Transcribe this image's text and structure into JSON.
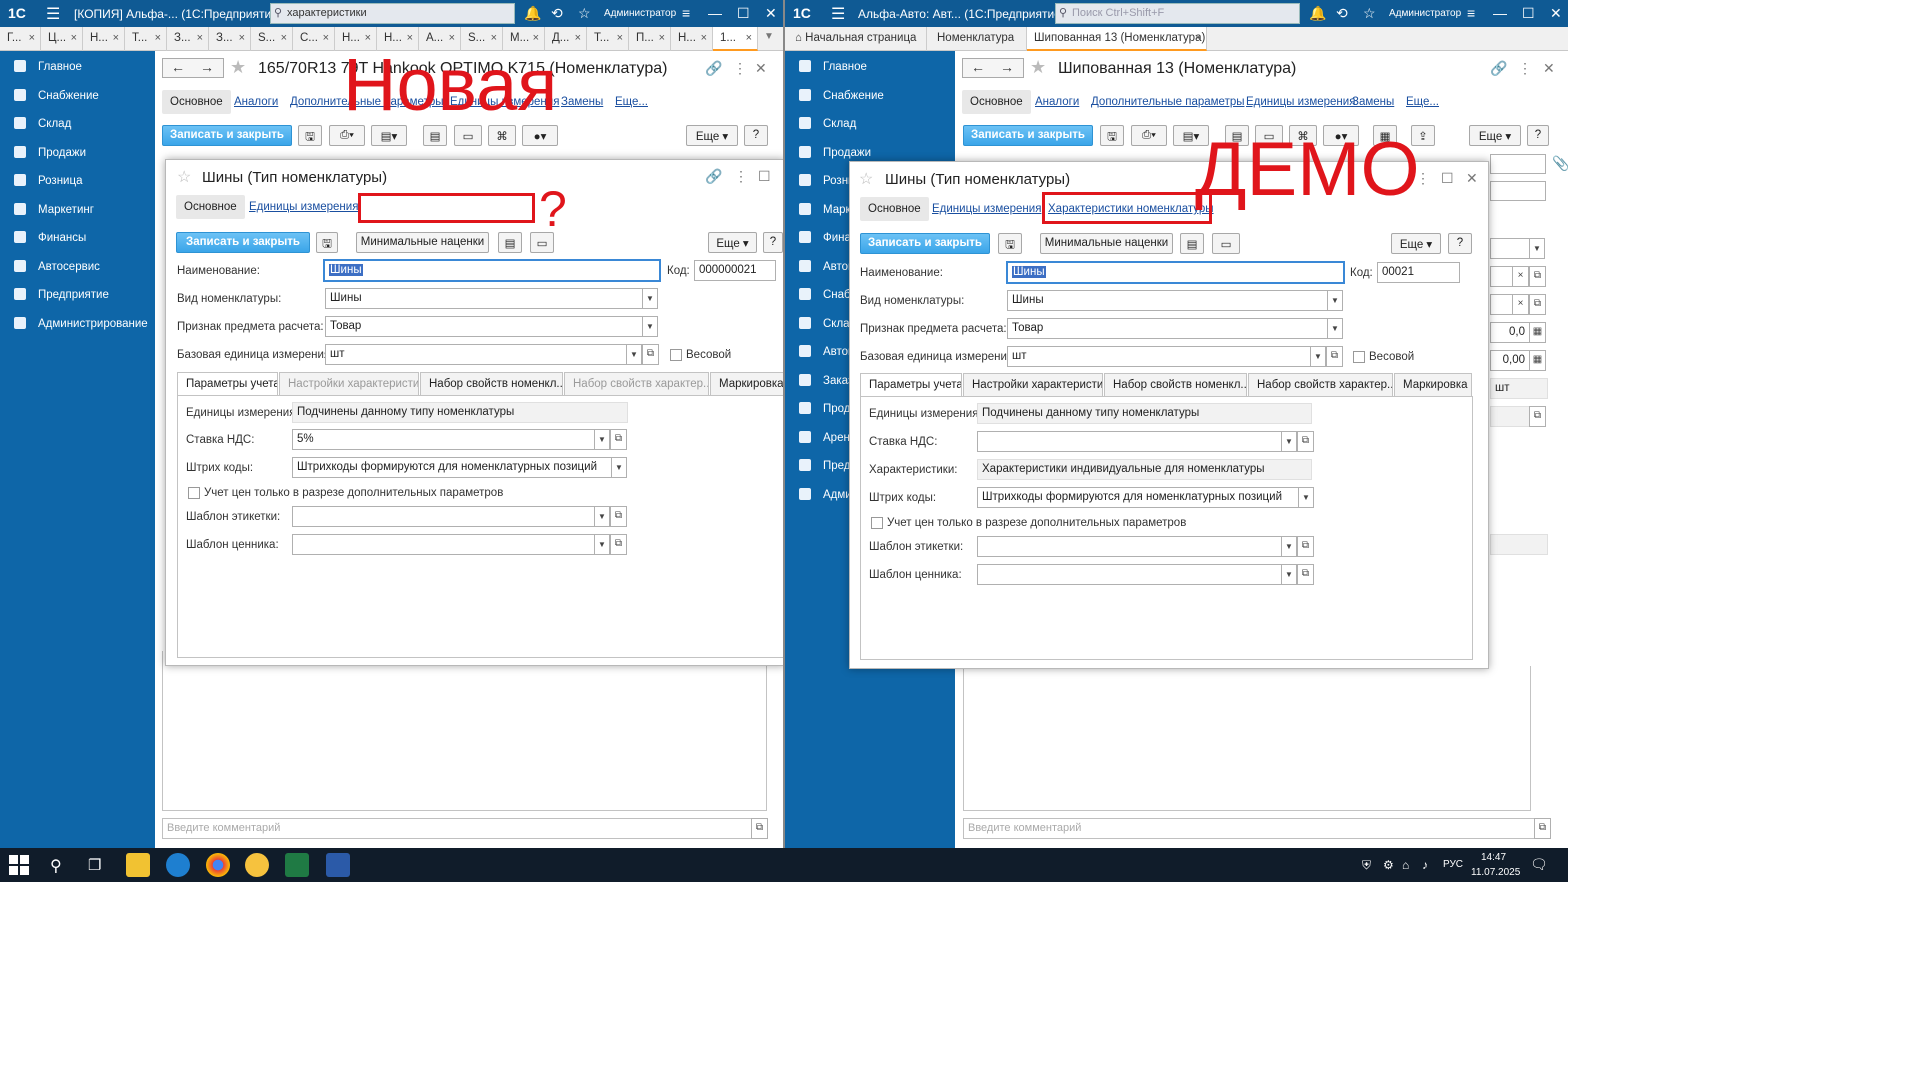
{
  "left": {
    "title": "[КОПИЯ] Альфа-... (1С:Предприятие)",
    "search_value": "характеристики",
    "user": "Администратор",
    "tabs": [
      "Г...",
      "Ц...",
      "Н...",
      "Т...",
      "З...",
      "З...",
      "S...",
      "С...",
      "Н...",
      "Н...",
      "А...",
      "S...",
      "М...",
      "Д...",
      "Т...",
      "П...",
      "Н...",
      "1..."
    ],
    "form_title": "165/70R13 79T Hankook OPTIMO K715 (Номенклатура)",
    "nav": [
      "Основное",
      "Аналоги",
      "Дополнительные параметры",
      "Единицы измерения",
      "Замены",
      "Еще..."
    ],
    "save_close": "Записать и закрыть",
    "more": "Еще",
    "help": "?",
    "comment_placeholder": "Введите комментарий",
    "annotation": "Новая",
    "annotation_q": "?",
    "dialog": {
      "title": "Шины (Тип номенклатуры)",
      "nav_main": "Основное",
      "nav_units": "Единицы измерения",
      "save_close": "Записать и закрыть",
      "min_markup": "Минимальные наценки",
      "more": "Еще",
      "help": "?",
      "name_label": "Наименование:",
      "name_value": "Шины",
      "code_label": "Код:",
      "code_value": "000000021",
      "kind_label": "Вид номенклатуры:",
      "kind_value": "Шины",
      "attr_label": "Признак предмета расчета:",
      "attr_value": "Товар",
      "unit_label": "Базовая единица измерения:",
      "unit_value": "шт",
      "weight_label": "Весовой",
      "tabs": [
        "Параметры учета",
        "Настройки характеристик",
        "Набор свойств номенкл...",
        "Набор свойств характер...",
        "Маркировка"
      ],
      "units_label": "Единицы измерения:",
      "units_value": "Подчинены данному типу номенклатуры",
      "vat_label": "Ставка НДС:",
      "vat_value": "5%",
      "barcode_label": "Штрих коды:",
      "barcode_value": "Штрихкоды формируются для номенклатурных позиций",
      "price_check": "Учет цен только в разрезе дополнительных параметров",
      "label_tpl": "Шаблон этикетки:",
      "price_tpl": "Шаблон ценника:"
    }
  },
  "right": {
    "title": "Альфа-Авто: Авт... (1С:Предприятие)",
    "search_placeholder": "Поиск Ctrl+Shift+F",
    "user": "Администратор",
    "tabs": [
      "Начальная страница",
      "Номенклатура",
      "Шипованная 13 (Номенклатура)"
    ],
    "form_title": "Шипованная 13 (Номенклатура)",
    "nav": [
      "Основное",
      "Аналоги",
      "Дополнительные параметры",
      "Единицы измерения",
      "Замены",
      "Еще..."
    ],
    "save_close": "Записать и закрыть",
    "more": "Еще",
    "help": "?",
    "comment_placeholder": "Введите комментарий",
    "annotation": "ДЕМО",
    "side_values": [
      "0,0",
      "0,00",
      "шт"
    ],
    "dialog": {
      "title": "Шины (Тип номенклатуры)",
      "nav_main": "Основное",
      "nav_units": "Единицы измерения",
      "nav_chars": "Характеристики номенклатуры",
      "save_close": "Записать и закрыть",
      "min_markup": "Минимальные наценки",
      "more": "Еще",
      "help": "?",
      "name_label": "Наименование:",
      "name_value": "Шины",
      "code_label": "Код:",
      "code_value": "00021",
      "kind_label": "Вид номенклатуры:",
      "kind_value": "Шины",
      "attr_label": "Признак предмета расчета:",
      "attr_value": "Товар",
      "unit_label": "Базовая единица измерения:",
      "unit_value": "шт",
      "weight_label": "Весовой",
      "tabs": [
        "Параметры учета",
        "Настройки характеристик",
        "Набор свойств номенкл...",
        "Набор свойств характер...",
        "Маркировка"
      ],
      "units_label": "Единицы измерения:",
      "units_value": "Подчинены данному типу номенклатуры",
      "vat_label": "Ставка НДС:",
      "vat_value": "",
      "chars_label": "Характеристики:",
      "chars_value": "Характеристики индивидуальные для номенклатуры",
      "barcode_label": "Штрих коды:",
      "barcode_value": "Штрихкоды формируются для номенклатурных позиций",
      "price_check": "Учет цен только в разрезе дополнительных параметров",
      "label_tpl": "Шаблон этикетки:",
      "price_tpl": "Шаблон ценника:"
    }
  },
  "sidebar_left": [
    "Главное",
    "Снабжение",
    "Склад",
    "Продажи",
    "Розница",
    "Маркетинг",
    "Финансы",
    "Автосервис",
    "Предприятие",
    "Администрирование"
  ],
  "sidebar_right": [
    "Главное",
    "Снабжение",
    "Склад",
    "Продажи",
    "Розни",
    "Марк",
    "Фина",
    "Автом",
    "Снабж",
    "Склад",
    "Автом",
    "Заказ",
    "Прода",
    "Аренд",
    "Предп",
    "Адми"
  ],
  "taskbar": {
    "lang": "РУС",
    "time": "14:47",
    "date": "11.07.2025"
  },
  "colors": {
    "titlebar": "#0f5a94",
    "sidebar": "#0e66a8",
    "primary_button": "#3aa5e9",
    "annotation": "#e0151b",
    "active_tab": "#ff9a1f"
  }
}
